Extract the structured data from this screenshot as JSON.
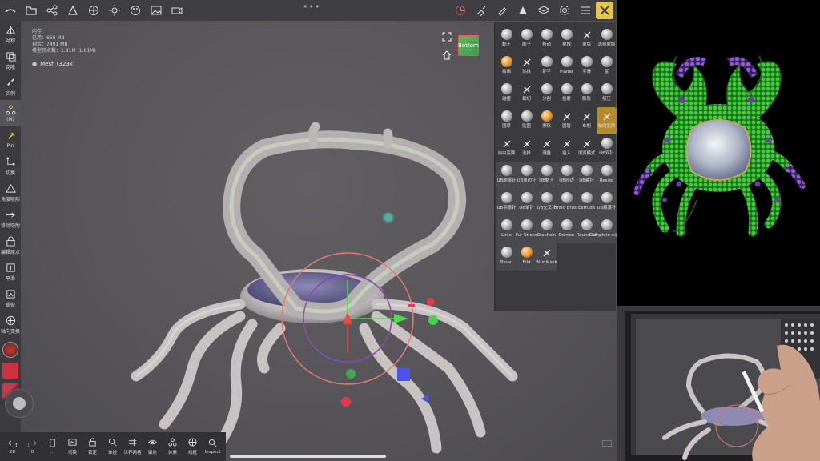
{
  "top_bar": {
    "icons": [
      "logo-icon",
      "folder-icon",
      "share-icon",
      "scene-icon",
      "globe-icon",
      "sun-icon",
      "palette-icon",
      "image-icon",
      "video-icon"
    ],
    "more": "•••",
    "right_icons": [
      "gizmo-icon",
      "brush-icon",
      "paint-icon",
      "material-icon",
      "layers-icon",
      "settings-icon",
      "sliders-icon",
      "hide-panels-icon"
    ]
  },
  "left_tools": [
    {
      "label": "对称",
      "icon": "symmetry-icon"
    },
    {
      "label": "克隆",
      "icon": "clone-icon"
    },
    {
      "label": "实例",
      "icon": "instance-icon"
    },
    {
      "label": "(M)",
      "icon": "graph-icon"
    },
    {
      "label": "Pin",
      "icon": "pin-icon"
    },
    {
      "label": "切换",
      "icon": "toggle-icon"
    },
    {
      "label": "角度吸附",
      "icon": "angle-snap-icon"
    },
    {
      "label": "移动吸附",
      "icon": "move-snap-icon"
    },
    {
      "label": "编辑原点",
      "icon": "edit-origin-icon"
    },
    {
      "label": "平滑",
      "icon": "smooth-icon"
    },
    {
      "label": "重做",
      "icon": "redo-icon"
    },
    {
      "label": "轴向变换",
      "icon": "axis-transform-icon"
    }
  ],
  "info": {
    "title": "内存",
    "used": "已用：656 MB",
    "total": "剩余：7491 MB",
    "verts": "模型顶点数：1.81M (1.81M)",
    "mesh": "Mesh (323k)"
  },
  "view_cube": {
    "label": "Bottom"
  },
  "brushes": [
    {
      "label": "黏土",
      "style": "ball"
    },
    {
      "label": "刷子",
      "style": "ball"
    },
    {
      "label": "移动",
      "style": "ball"
    },
    {
      "label": "拖拽",
      "style": "ball"
    },
    {
      "label": "蒙版",
      "style": "flat"
    },
    {
      "label": "选择蒙版",
      "style": "ball"
    },
    {
      "label": "绘画",
      "style": "orange"
    },
    {
      "label": "涂抹",
      "style": "flat"
    },
    {
      "label": "铲平",
      "style": "ball"
    },
    {
      "label": "Planar",
      "style": "ball"
    },
    {
      "label": "平滑",
      "style": "ball"
    },
    {
      "label": "置",
      "style": "ball"
    },
    {
      "label": "碰撞",
      "style": "ball"
    },
    {
      "label": "裁切",
      "style": "flat"
    },
    {
      "label": "分割",
      "style": "ball"
    },
    {
      "label": "投射",
      "style": "ball"
    },
    {
      "label": "膨胀",
      "style": "ball"
    },
    {
      "label": "挤压",
      "style": "ball"
    },
    {
      "label": "图章",
      "style": "ball"
    },
    {
      "label": "贴图",
      "style": "ball"
    },
    {
      "label": "擦除",
      "style": "orange"
    },
    {
      "label": "圆管",
      "style": "flat"
    },
    {
      "label": "车削",
      "style": "flat"
    },
    {
      "label": "轴向变换",
      "style": "sel"
    },
    {
      "label": "自由变换",
      "style": "flat"
    },
    {
      "label": "选择",
      "style": "flat"
    },
    {
      "label": "测量",
      "style": "flat"
    },
    {
      "label": "插入",
      "style": "flat"
    },
    {
      "label": "浏览模式",
      "style": "flat"
    },
    {
      "label": "UB双针",
      "style": "ball"
    },
    {
      "label": "UB刷滚针",
      "style": "ball"
    },
    {
      "label": "UB单边针",
      "style": "ball"
    },
    {
      "label": "UB黏土",
      "style": "ball"
    },
    {
      "label": "UB抓边",
      "style": "ball"
    },
    {
      "label": "UB藏针",
      "style": "ball"
    },
    {
      "label": "Resize",
      "style": "ball"
    },
    {
      "label": "UB钢滚针",
      "style": "ball"
    },
    {
      "label": "UB单针",
      "style": "ball"
    },
    {
      "label": "UB交叉针",
      "style": "ball"
    },
    {
      "label": "Braid Brush",
      "style": "ball"
    },
    {
      "label": "Extrude",
      "style": "ball"
    },
    {
      "label": "UB藏滚针",
      "style": "ball"
    },
    {
      "label": "Linie",
      "style": "ball"
    },
    {
      "label": "Fur Stroke",
      "style": "ball"
    },
    {
      "label": "Stacheln",
      "style": "ball"
    },
    {
      "label": "Dornen",
      "style": "ball"
    },
    {
      "label": "Round All",
      "style": "ball"
    },
    {
      "label": "Complete Alpha",
      "style": "ball"
    },
    {
      "label": "Bevel",
      "style": "ball"
    },
    {
      "label": "Bild",
      "style": "orange"
    },
    {
      "label": "Blur Mask",
      "style": "flat"
    }
  ],
  "bottom_bar": [
    {
      "label": "28",
      "icon": "undo-icon"
    },
    {
      "label": "0",
      "icon": "redo-icon"
    },
    {
      "label": "...",
      "icon": "phone-icon"
    },
    {
      "label": "切换",
      "icon": "switch-icon"
    },
    {
      "label": "锁定",
      "icon": "lock-icon"
    },
    {
      "label": "单投",
      "icon": "search-icon"
    },
    {
      "label": "世界网格",
      "icon": "grid-icon"
    },
    {
      "label": "聚焦",
      "icon": "eye-icon"
    },
    {
      "label": "体素",
      "icon": "voxel-icon"
    },
    {
      "label": "线框",
      "icon": "wireframe-icon"
    },
    {
      "label": "Inspect",
      "icon": "inspect-icon"
    }
  ],
  "colors": {
    "accent": "#e2c54a",
    "panel": "#3b3a3e",
    "viewport": "#575559",
    "swatch_primary": "#cf3140",
    "swatch_secondary": "#c23a4c"
  }
}
